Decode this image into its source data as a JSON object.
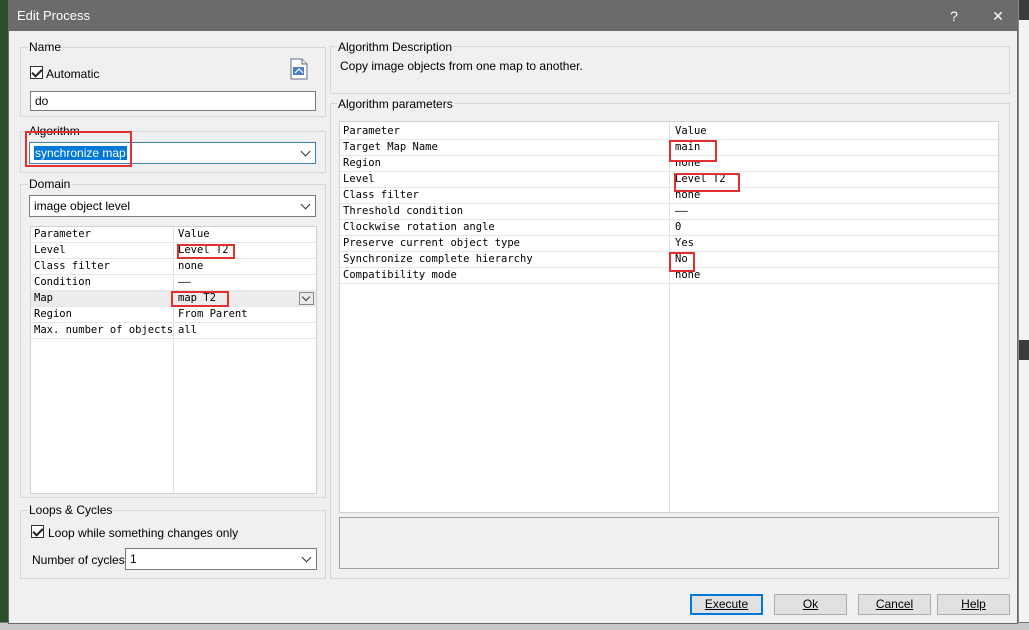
{
  "dialog": {
    "title": "Edit Process",
    "help_glyph": "?",
    "close_glyph": "✕"
  },
  "name_group": {
    "label": "Name",
    "automatic_label": "Automatic",
    "automatic_checked": true,
    "value": "do"
  },
  "algorithm_group": {
    "label": "Algorithm",
    "selected": "synchronize map"
  },
  "domain_group": {
    "label": "Domain",
    "selected": "image object level",
    "header": {
      "parameter": "Parameter",
      "value": "Value"
    },
    "rows": [
      {
        "parameter": "Level",
        "value": "Level T2"
      },
      {
        "parameter": "Class filter",
        "value": "none"
      },
      {
        "parameter": "Condition",
        "value": "——"
      },
      {
        "parameter": "Map",
        "value": "map T2"
      },
      {
        "parameter": "Region",
        "value": "From Parent"
      },
      {
        "parameter": "Max. number of objects",
        "value": "all"
      }
    ]
  },
  "loops_group": {
    "label": "Loops & Cycles",
    "loop_label": "Loop while something changes only",
    "loop_checked": true,
    "cycles_label": "Number of cycles",
    "cycles_value": "1"
  },
  "description_group": {
    "label": "Algorithm Description",
    "text": "Copy image objects from one map to another."
  },
  "params_group": {
    "label": "Algorithm parameters",
    "header": {
      "parameter": "Parameter",
      "value": "Value"
    },
    "rows": [
      {
        "parameter": "Target Map Name",
        "value": "main"
      },
      {
        "parameter": "Region",
        "value": "none"
      },
      {
        "parameter": "Level",
        "value": "Level T2"
      },
      {
        "parameter": "Class filter",
        "value": "none"
      },
      {
        "parameter": "Threshold condition",
        "value": "——"
      },
      {
        "parameter": "Clockwise rotation angle",
        "value": "0"
      },
      {
        "parameter": "Preserve current object type",
        "value": "Yes"
      },
      {
        "parameter": "Synchronize complete hierarchy",
        "value": "No"
      },
      {
        "parameter": "Compatibility mode",
        "value": "none"
      }
    ]
  },
  "buttons": {
    "execute": "Execute",
    "ok": "Ok",
    "cancel": "Cancel",
    "help": "Help"
  },
  "colors": {
    "annotation": "#e03030",
    "selection": "#0078d7",
    "titlebar": "#6b6b6b"
  }
}
